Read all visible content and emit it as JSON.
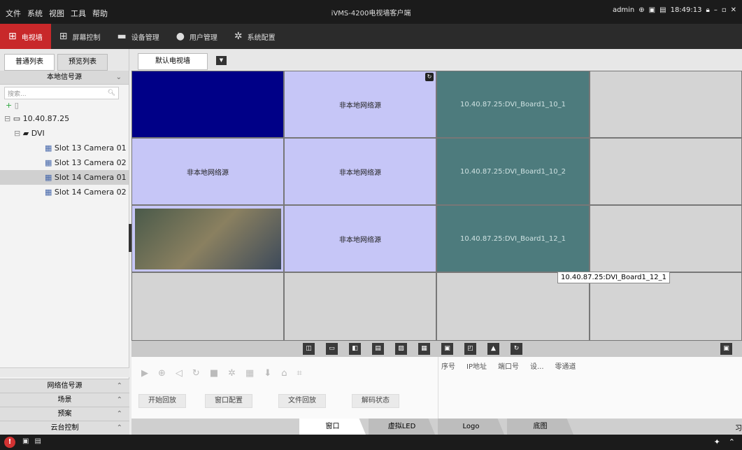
{
  "titlebar": {
    "menus": [
      "文件",
      "系统",
      "视图",
      "工具",
      "帮助"
    ],
    "title": "iVMS-4200电视墙客户端",
    "user": "admin",
    "time": "18:49:13"
  },
  "modules": [
    {
      "label": "电视墙",
      "icon": "tv-wall-icon",
      "active": true
    },
    {
      "label": "屏幕控制",
      "icon": "screen-control-icon",
      "active": false
    },
    {
      "label": "设备管理",
      "icon": "device-icon",
      "active": false
    },
    {
      "label": "用户管理",
      "icon": "user-icon",
      "active": false
    },
    {
      "label": "系统配置",
      "icon": "gear-icon",
      "active": false
    }
  ],
  "sidebar": {
    "tabs": [
      "普通列表",
      "预览列表"
    ],
    "section": "本地信号源",
    "search_placeholder": "搜索...",
    "tree": [
      "10.40.87.25",
      "DVI",
      "Slot 13 Camera 01",
      "Slot 13 Camera 02",
      "Slot 14 Camera 01",
      "Slot 14 Camera 02"
    ],
    "bottom": [
      "网络信号源",
      "场景",
      "预案",
      "云台控制"
    ]
  },
  "wall": {
    "tab": "默认电视墙",
    "nonlocal": "非本地网络源",
    "dvi10_1": "10.40.87.25:DVI_Board1_10_1",
    "dvi10_2": "10.40.87.25:DVI_Board1_10_2",
    "dvi12_1": "10.40.87.25:DVI_Board1_12_1",
    "tooltip": "10.40.87.25:DVI_Board1_12_1"
  },
  "controls": {
    "buttons": [
      "开始回放",
      "窗口配置",
      "文件回放",
      "解码状态"
    ]
  },
  "channels": {
    "headers": [
      "序号",
      "IP地址",
      "端口号",
      "设...",
      "零通道"
    ]
  },
  "bottomtabs": {
    "tabs": [
      "窗口",
      "虚拟LED",
      "Logo",
      "底图"
    ],
    "trail": "习"
  }
}
